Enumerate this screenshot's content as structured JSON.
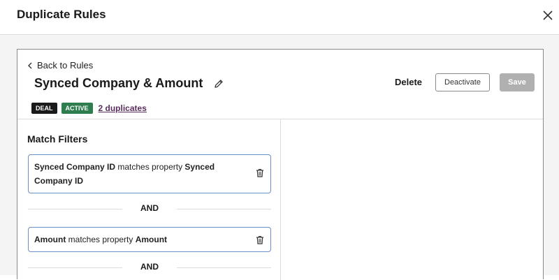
{
  "modal": {
    "title": "Duplicate Rules"
  },
  "rule": {
    "back_label": "Back to Rules",
    "title": "Synced Company & Amount",
    "delete_label": "Delete",
    "deactivate_label": "Deactivate",
    "save_label": "Save",
    "badges": {
      "deal": "DEAL",
      "active": "ACTIVE"
    },
    "duplicates_link": "2 duplicates"
  },
  "match_filters": {
    "title": "Match Filters",
    "filters": [
      {
        "prop": "Synced Company ID",
        "middle": " matches property ",
        "target": "Synced Company ID"
      },
      {
        "prop": "Amount",
        "middle": " matches property ",
        "target": "Amount"
      }
    ],
    "and_label": "AND"
  },
  "colors": {
    "active_badge": "#2e7d4f",
    "deal_badge": "#1a1a1a",
    "link": "#5a2d5e",
    "filter_border": "#6b8fc9"
  }
}
